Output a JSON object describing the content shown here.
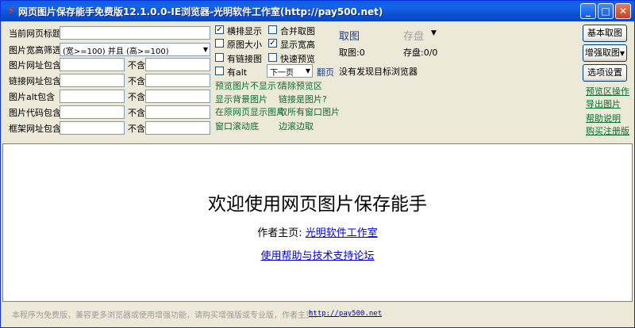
{
  "window": {
    "title": "网页图片保存能手免费版12.1.0.0-IE浏览器-光明软件工作室(http://pay500.net)"
  },
  "form": {
    "page_title_label": "当前网页标题",
    "page_title_value": "",
    "size_filter_label": "图片宽高筛选",
    "size_filter_value": "(宽>=100) 并且 (高>=100)",
    "rows": [
      {
        "label": "图片网址包含",
        "exclude_label": "不含"
      },
      {
        "label": "链接网址包含",
        "exclude_label": "不含"
      },
      {
        "label": "图片alt包含",
        "exclude_label": "不含"
      },
      {
        "label": "图片代码包含",
        "exclude_label": "不含"
      },
      {
        "label": "框架网址包含",
        "exclude_label": "不含"
      }
    ]
  },
  "options": {
    "horizontal": {
      "label": "横排显示",
      "checked": "✓"
    },
    "merge": {
      "label": "合并取图",
      "checked": ""
    },
    "original": {
      "label": "原图大小",
      "checked": ""
    },
    "show_size": {
      "label": "显示宽高",
      "checked": "✓"
    },
    "has_link": {
      "label": "有链接图",
      "checked": ""
    },
    "fast_preview": {
      "label": "快速预览",
      "checked": ""
    },
    "has_alt": {
      "label": "有alt",
      "checked": ""
    },
    "next_page_value": "下一页",
    "flip_label": "翻页"
  },
  "links": {
    "preview_missing": "预览图片不显示?",
    "clear_preview": "清除预览区",
    "show_bg": "显示背景图片",
    "link_is_image": "链接是图片?",
    "show_original_page": "在原网页显示图片",
    "get_all_windows": "取所有窗口图片",
    "scroll_bottom": "窗口滚动底",
    "scroll_get": "边滚边取"
  },
  "status_area": {
    "fetch_title": "取图",
    "save_title": "存盘",
    "fetch_count": "取图:0",
    "save_count": "存盘:0/0",
    "no_browser": "没有发现目标浏览器"
  },
  "buttons": {
    "basic_fetch": "基本取图",
    "enhanced_fetch": "增强取图",
    "options": "选项设置"
  },
  "side_links": {
    "preview_ops": "预览区操作",
    "export": "导出图片",
    "help": "帮助说明",
    "buy": "购买注册版"
  },
  "welcome": {
    "heading": "欢迎使用网页图片保存能手",
    "author_label": "作者主页:",
    "author_link": "光明软件工作室",
    "forum_link": "使用帮助与技术支持论坛"
  },
  "footer": {
    "notice": "本程序为免费版，兼容更多浏览器或使用增强功能，请购买增强版或专业版，作者主页：",
    "url": "http://pay500.net"
  }
}
